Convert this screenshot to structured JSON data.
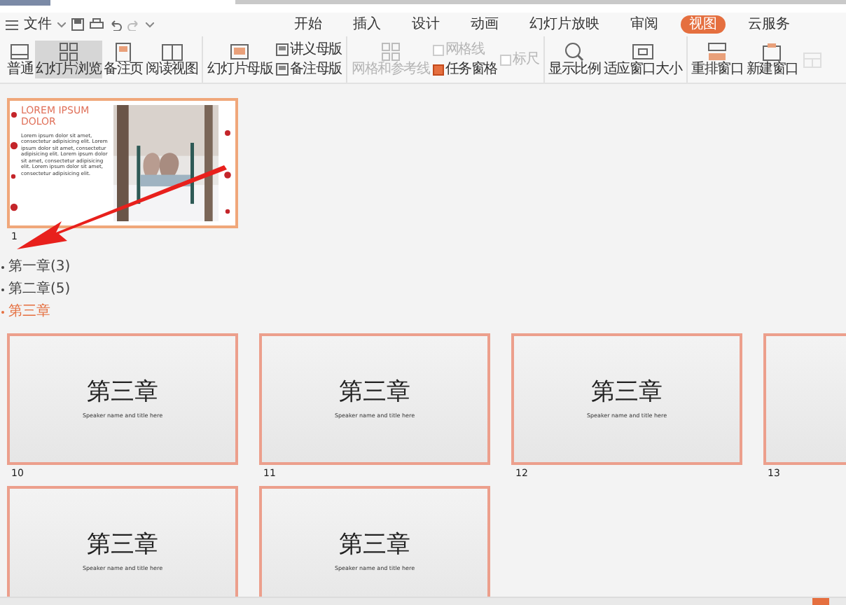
{
  "menu": {
    "file_label": "文件"
  },
  "tabs": [
    {
      "label": "开始",
      "selected": false
    },
    {
      "label": "插入",
      "selected": false
    },
    {
      "label": "设计",
      "selected": false
    },
    {
      "label": "动画",
      "selected": false
    },
    {
      "label": "幻灯片放映",
      "selected": false
    },
    {
      "label": "审阅",
      "selected": false
    },
    {
      "label": "视图",
      "selected": true
    },
    {
      "label": "云服务",
      "selected": false
    }
  ],
  "ribbon": {
    "groups": [
      [
        [
          {
            "kind": "big",
            "label": "普通",
            "selected": false,
            "disabled": false
          }
        ],
        [
          {
            "kind": "big",
            "label": "幻灯片浏览",
            "selected": true,
            "disabled": false
          }
        ],
        [
          {
            "kind": "big",
            "label": "备注页",
            "selected": false,
            "disabled": false
          }
        ],
        [
          {
            "kind": "big",
            "label": "阅读视图",
            "selected": false,
            "disabled": false
          }
        ]
      ],
      [
        [
          {
            "kind": "big",
            "label": "幻灯片母版",
            "disabled": false
          }
        ],
        [
          {
            "kind": "small",
            "label": "讲义母版",
            "disabled": false
          },
          {
            "kind": "small",
            "label": "备注母版",
            "disabled": false
          }
        ]
      ],
      [
        [
          {
            "kind": "big",
            "label": "网格和参考线",
            "disabled": true
          }
        ],
        [
          {
            "kind": "check",
            "label": "网格线",
            "checked": false,
            "disabled": true
          },
          {
            "kind": "check",
            "label": "任务窗格",
            "checked": true,
            "disabled": false
          }
        ],
        [
          {
            "kind": "check",
            "label": "标尺",
            "checked": false,
            "disabled": true
          }
        ]
      ],
      [
        [
          {
            "kind": "big",
            "label": "显示比例",
            "disabled": false
          }
        ],
        [
          {
            "kind": "big",
            "label": "适应窗口大小",
            "disabled": false
          }
        ]
      ],
      [
        [
          {
            "kind": "big",
            "label": "重排窗口",
            "disabled": false
          }
        ],
        [
          {
            "kind": "big",
            "label": "新建窗口",
            "disabled": false
          }
        ],
        [
          {
            "kind": "big",
            "disabled": true
          }
        ]
      ]
    ]
  },
  "first_slide": {
    "number": "1",
    "title": "LOREM IPSUM DOLOR",
    "body": "Lorem ipsum dolor sit amet, consectetur adipisicing elit. Lorem ipsum dolor sit amet, consectetur adipisicing elit. Lorem ipsum dolor sit amet, consectetur adipisicing elit. Lorem ipsum dolor sit amet, consectetur adipisicing elit."
  },
  "sections": [
    {
      "label": "第一章(3)",
      "selected": false
    },
    {
      "label": "第二章(5)",
      "selected": false
    },
    {
      "label": "第三章",
      "selected": true
    }
  ],
  "slides": [
    {
      "number": "10",
      "title": "第三章",
      "subtitle": "Speaker name and title here"
    },
    {
      "number": "11",
      "title": "第三章",
      "subtitle": "Speaker name and title here"
    },
    {
      "number": "12",
      "title": "第三章",
      "subtitle": "Speaker name and title here"
    },
    {
      "number": "13"
    },
    {
      "title": "第三章",
      "subtitle": "Speaker name and title here"
    },
    {
      "title": "第三章",
      "subtitle": "Speaker name and title here"
    }
  ]
}
